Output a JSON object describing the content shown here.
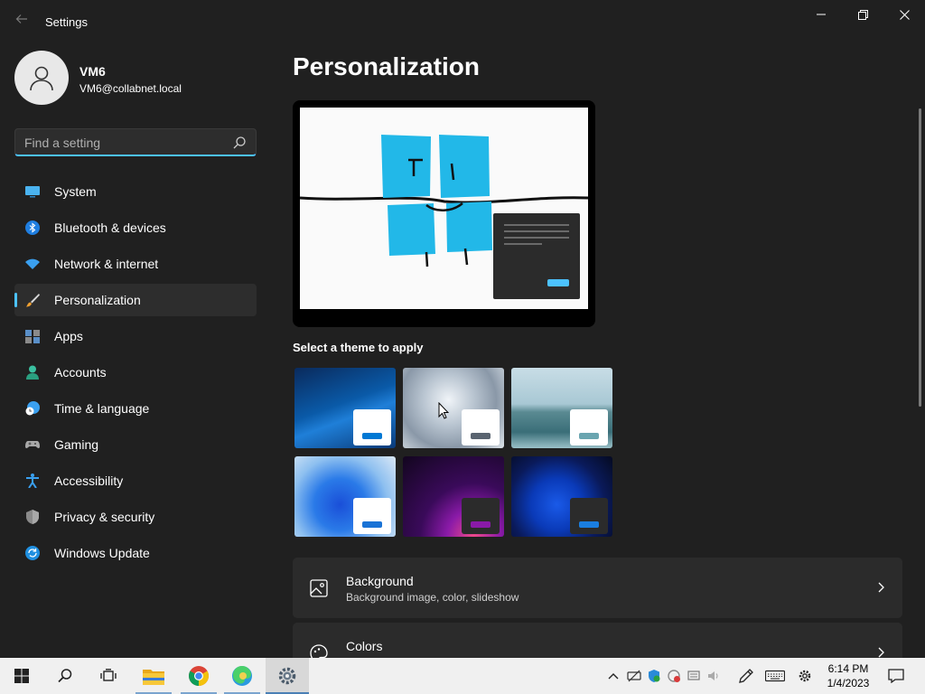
{
  "window": {
    "title": "Settings"
  },
  "user": {
    "name": "VM6",
    "email": "VM6@collabnet.local"
  },
  "search": {
    "placeholder": "Find a setting"
  },
  "nav": {
    "items": [
      {
        "label": "System",
        "icon": "monitor-icon"
      },
      {
        "label": "Bluetooth & devices",
        "icon": "bluetooth-icon"
      },
      {
        "label": "Network & internet",
        "icon": "wifi-icon"
      },
      {
        "label": "Personalization",
        "icon": "brush-icon",
        "selected": true
      },
      {
        "label": "Apps",
        "icon": "apps-icon"
      },
      {
        "label": "Accounts",
        "icon": "person-icon"
      },
      {
        "label": "Time & language",
        "icon": "clock-globe-icon"
      },
      {
        "label": "Gaming",
        "icon": "gamepad-icon"
      },
      {
        "label": "Accessibility",
        "icon": "accessibility-icon"
      },
      {
        "label": "Privacy & security",
        "icon": "shield-icon"
      },
      {
        "label": "Windows Update",
        "icon": "update-icon"
      }
    ]
  },
  "main": {
    "title": "Personalization",
    "themes_heading": "Select a theme to apply",
    "themes": [
      {
        "name": "windows-blue",
        "mini_color": "#0078d4"
      },
      {
        "name": "glow-light",
        "mini_color": "#5a6470"
      },
      {
        "name": "captured-motion",
        "mini_color": "#6aa5b0"
      },
      {
        "name": "bloom-light",
        "mini_color": "#1a73d6"
      },
      {
        "name": "flow-dark",
        "mini_color": "#8a1aa8"
      },
      {
        "name": "bloom-dark",
        "mini_color": "#1a7ee0"
      }
    ],
    "cards": [
      {
        "title": "Background",
        "subtitle": "Background image, color, slideshow",
        "icon": "image-icon"
      },
      {
        "title": "Colors",
        "subtitle": "",
        "icon": "palette-icon"
      }
    ]
  },
  "taskbar": {
    "apps": [
      "start-icon",
      "search-icon",
      "task-view-icon",
      "file-explorer-icon",
      "chrome-icon",
      "edge-icon",
      "settings-icon"
    ],
    "time": "6:14 PM",
    "date": "1/4/2023"
  },
  "colors": {
    "accent": "#4cc2ff",
    "background": "#202020",
    "card": "#2b2b2b"
  }
}
